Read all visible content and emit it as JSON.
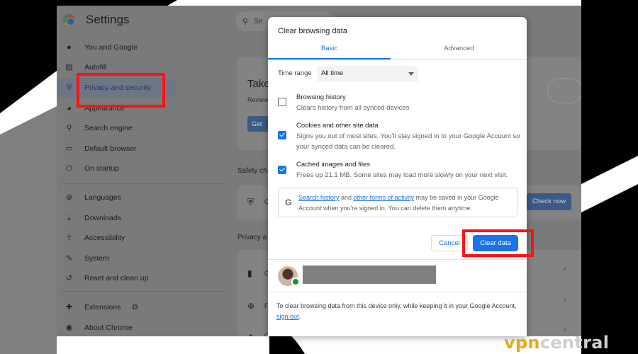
{
  "app": {
    "title": "Settings",
    "search_placeholder": "Se"
  },
  "sidebar": {
    "items": [
      {
        "label": "You and Google",
        "icon": "person-icon"
      },
      {
        "label": "Autofill",
        "icon": "autofill-icon"
      },
      {
        "label": "Privacy and security",
        "icon": "shield-icon",
        "active": true
      },
      {
        "label": "Appearance",
        "icon": "palette-icon"
      },
      {
        "label": "Search engine",
        "icon": "search-icon"
      },
      {
        "label": "Default browser",
        "icon": "browser-icon"
      },
      {
        "label": "On startup",
        "icon": "power-icon"
      },
      {
        "label": "Languages",
        "icon": "globe-icon"
      },
      {
        "label": "Downloads",
        "icon": "download-icon"
      },
      {
        "label": "Accessibility",
        "icon": "accessibility-icon"
      },
      {
        "label": "System",
        "icon": "wrench-icon"
      },
      {
        "label": "Reset and clean up",
        "icon": "reset-icon"
      },
      {
        "label": "Extensions",
        "icon": "puzzle-icon"
      },
      {
        "label": "About Chrome",
        "icon": "chrome-icon"
      }
    ]
  },
  "main": {
    "card_title": "Take",
    "card_sub": "Review",
    "card_button": "Get",
    "safety_heading": "Safety ch",
    "safety_text": "C",
    "check_now": "Check now",
    "privacy_heading": "Privacy a",
    "privacy_rows": [
      "C",
      "F",
      "C"
    ]
  },
  "dialog": {
    "title": "Clear browsing data",
    "tabs": {
      "basic": "Basic",
      "advanced": "Advanced"
    },
    "time_range_label": "Time range",
    "time_range_value": "All time",
    "options": [
      {
        "title": "Browsing history",
        "desc": "Clears history from all synced devices",
        "checked": false
      },
      {
        "title": "Cookies and other site data",
        "desc": "Signs you out of most sites. You'll stay signed in to your Google Account so your synced data can be cleared.",
        "checked": true
      },
      {
        "title": "Cached images and files",
        "desc": "Frees up 21.1 MB. Some sites may load more slowly on your next visit.",
        "checked": true
      }
    ],
    "info": {
      "g_logo": "G",
      "link1": "Search history",
      "and": " and ",
      "link2": "other forms of activity",
      "rest": " may be saved in your Google Account when you're signed in. You can delete them anytime."
    },
    "cancel_label": "Cancel",
    "clear_label": "Clear data",
    "footer": {
      "text": "To clear browsing data from this device only, while keeping it in your Google Account, ",
      "link": "sign out",
      "end": "."
    }
  },
  "brand": {
    "part1": "vpn",
    "part2": "central"
  },
  "colors": {
    "accent": "#1a73e8",
    "highlight": "#ff1212",
    "brand": "#e8a81a"
  }
}
